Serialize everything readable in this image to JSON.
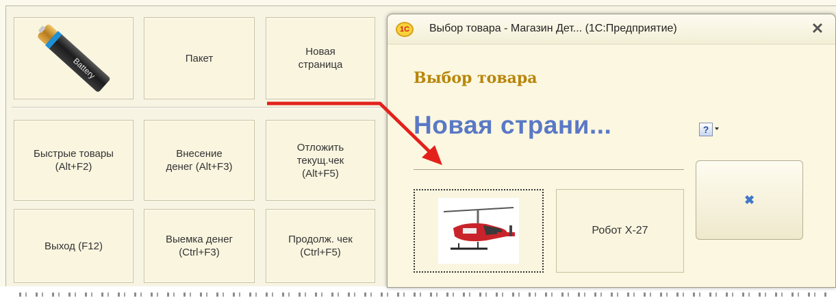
{
  "tiles": {
    "battery_label": "Battery",
    "paket": "Пакет",
    "new_page": "Новая\nстраница",
    "fast_goods": "Быстрые товары\n(Alt+F2)",
    "cash_in": "Внесение\nденег (Alt+F3)",
    "postpone_check": "Отложить\nтекущ.чек\n(Alt+F5)",
    "exit": "Выход (F12)",
    "cash_out": "Выемка денег\n(Ctrl+F3)",
    "continue_check": "Продолж. чек\n(Ctrl+F5)"
  },
  "dialog": {
    "logo_text": "1C",
    "title": "Выбор товара - Магазин Дет...  (1С:Предприятие)",
    "close_glyph": "✕",
    "form_heading": "Выбор товара",
    "group_title": "Новая страни...",
    "help_glyph": "?",
    "item_robot": "Робот X-27",
    "close_button_glyph": "✖",
    "item_helicopter_icon": "helicopter-image"
  },
  "colors": {
    "heading_gold": "#b8860b",
    "group_title_blue": "#5a78c6",
    "arrow_red": "#e3211c"
  }
}
